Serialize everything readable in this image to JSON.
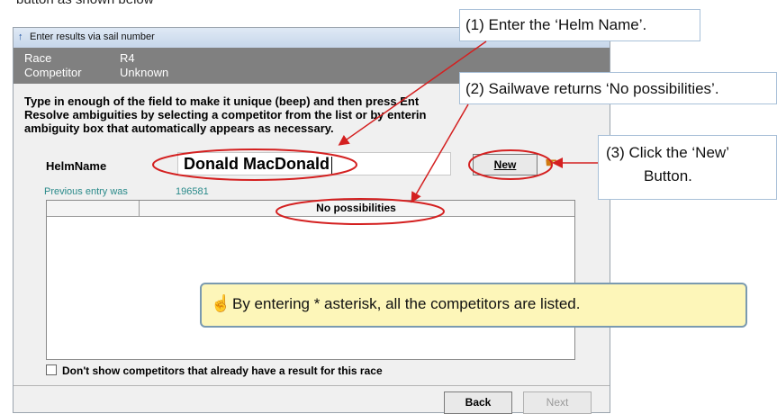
{
  "clipped_top_text": "button as shown below",
  "window": {
    "title": "Enter results via sail number",
    "race_label": "Race",
    "race_value": "R4",
    "competitor_label": "Competitor",
    "competitor_value": "Unknown"
  },
  "instructions": [
    "Type in enough of the field to make it unique (beep) and then press Ent",
    "Resolve ambiguities by selecting a competitor from the list or by enterin",
    "ambiguity box that automatically appears as necessary."
  ],
  "helm": {
    "label": "HelmName",
    "value": "Donald MacDonald",
    "new_button": "New"
  },
  "previous_entry": {
    "label": "Previous entry was",
    "value": "196581"
  },
  "list": {
    "header": "No possibilities"
  },
  "checkbox": {
    "label": "Don't show competitors that already have a result for this race",
    "checked": false
  },
  "buttons": {
    "back": "Back",
    "next": "Next"
  },
  "callouts": {
    "step1": "(1) Enter the ‘Helm Name’.",
    "step2": "(2) Sailwave returns ‘No possibilities’.",
    "step3_line1": "(3) Click the ‘New’",
    "step3_line2": "Button."
  },
  "tip": "By entering * asterisk, all the competitors are listed.",
  "colors": {
    "annotation_red": "#d42020",
    "tip_background": "#fdf6b9",
    "info_bar": "#808080"
  },
  "icons": {
    "window": "sailwave-icon",
    "tip": "pointing-hand-icon"
  }
}
